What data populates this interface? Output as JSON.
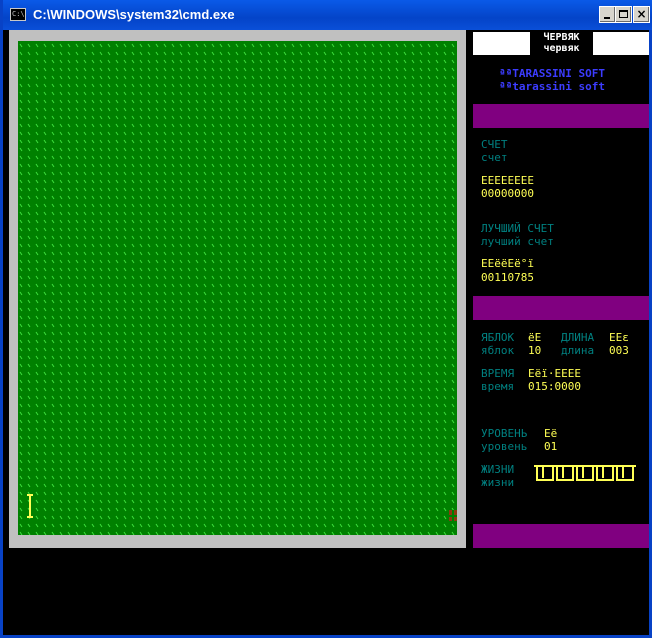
{
  "window": {
    "title": "C:\\WINDOWS\\system32\\cmd.exe",
    "icon_label": "C:\\",
    "minimize": "minimize-icon",
    "maximize": "maximize-icon",
    "close": "×"
  },
  "colors": {
    "arena_bg": "#008000",
    "grass_tick": "#55ff55",
    "frame": "#c0c0c0",
    "panel_bar": "#800080",
    "label_teal": "#008080",
    "value_yellow": "#ffff55",
    "credit_blue": "#3c3cff"
  },
  "game": {
    "title_top": "ЧЕРВЯК",
    "title_bottom": "червяк",
    "credit_line1": "ªªTARASSINI SOFT",
    "credit_line2": "ªªtarassini soft",
    "score": {
      "label_upper": "СЧЕТ",
      "label_lower": "счет",
      "value_glyphs": "EEEEEEEE",
      "value": "00000000"
    },
    "best_score": {
      "label_upper": "ЛУЧШИЙ СЧЕТ",
      "label_lower": "лучший счет",
      "value_glyphs": "EEëëEë°ï",
      "value": "00110785"
    },
    "apples": {
      "label_upper": "ЯБЛОК",
      "label_lower": "яблок",
      "value_glyphs": "ëE",
      "value": "10"
    },
    "length": {
      "label_upper": "ДЛИНА",
      "label_lower": "длина",
      "value_glyphs": "EEε",
      "value": "003"
    },
    "time": {
      "label_upper": "ВРЕМЯ",
      "label_lower": "время",
      "value_glyphs": "Eëï·EEEE",
      "value": "015:0000"
    },
    "level": {
      "label_upper": "УРОВЕНЬ",
      "label_lower": "уровень",
      "value_glyphs": "Eë",
      "value": "01"
    },
    "lives": {
      "label_upper": "ЖИЗНИ",
      "label_lower": "жизни",
      "count": 5
    }
  }
}
